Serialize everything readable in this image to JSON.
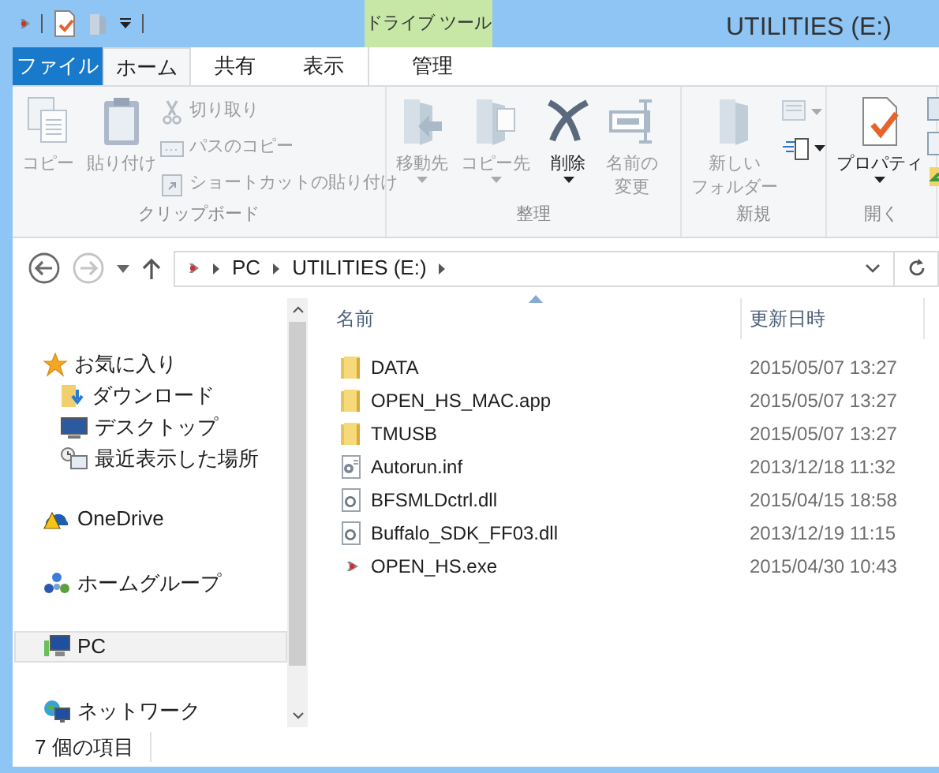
{
  "window": {
    "title": "UTILITIES (E:)"
  },
  "context_tab": {
    "label": "ドライブ ツール"
  },
  "tabs": [
    {
      "label": "ファイル",
      "kind": "file",
      "selected": false
    },
    {
      "label": "ホーム",
      "kind": "tab",
      "selected": true
    },
    {
      "label": "共有",
      "kind": "tab",
      "selected": false
    },
    {
      "label": "表示",
      "kind": "tab",
      "selected": false
    },
    {
      "label": "管理",
      "kind": "context",
      "selected": false
    }
  ],
  "ribbon_groups": [
    {
      "label": "クリップボード",
      "items": [
        {
          "kind": "copy",
          "lines": [
            "コピー"
          ],
          "disabled": true
        },
        {
          "kind": "paste",
          "lines": [
            "貼り付け"
          ],
          "disabled": true
        },
        {
          "kind": "cut",
          "lines": [
            "切り取り"
          ],
          "disabled": true
        },
        {
          "kind": "copypath",
          "lines": [
            "パスのコピー"
          ],
          "disabled": true
        },
        {
          "kind": "pasteshortcut",
          "lines": [
            "ショートカットの貼り付け"
          ],
          "disabled": true
        }
      ]
    },
    {
      "label": "整理",
      "items": [
        {
          "kind": "moveto",
          "lines": [
            "移動先"
          ],
          "disabled": true,
          "dropdown": true
        },
        {
          "kind": "copyto",
          "lines": [
            "コピー先"
          ],
          "disabled": true,
          "dropdown": true
        },
        {
          "kind": "delete",
          "lines": [
            "削除"
          ],
          "disabled": false,
          "dropdown": true
        },
        {
          "kind": "rename",
          "lines": [
            "名前の",
            "変更"
          ],
          "disabled": true
        }
      ]
    },
    {
      "label": "新規",
      "items": [
        {
          "kind": "newfolder",
          "lines": [
            "新しい",
            "フォルダー"
          ],
          "disabled": true
        },
        {
          "kind": "newitem",
          "disabled": true,
          "dropdown": true
        },
        {
          "kind": "easyaccess",
          "disabled": false,
          "dropdown": true
        }
      ]
    },
    {
      "label": "開く",
      "items": [
        {
          "kind": "properties",
          "lines": [
            "プロパティ"
          ],
          "disabled": false,
          "dropdown": true
        },
        {
          "kind": "openside"
        }
      ]
    }
  ],
  "navigation": {
    "back_disabled": false,
    "forward_disabled": true,
    "breadcrumbs": [
      "PC",
      "UTILITIES (E:)"
    ]
  },
  "sidebar": {
    "items": [
      {
        "kind": "favorites",
        "label": "お気に入り",
        "selected": false,
        "children": [
          {
            "kind": "downloads",
            "label": "ダウンロード",
            "selected": false
          },
          {
            "kind": "desktop",
            "label": "デスクトップ",
            "selected": false
          },
          {
            "kind": "recent",
            "label": "最近表示した場所",
            "selected": false
          }
        ]
      },
      {
        "kind": "onedrive",
        "label": "OneDrive",
        "selected": false
      },
      {
        "kind": "homegroup",
        "label": "ホームグループ",
        "selected": false
      },
      {
        "kind": "pc",
        "label": "PC",
        "selected": true
      },
      {
        "kind": "network",
        "label": "ネットワーク",
        "selected": false
      }
    ]
  },
  "table": {
    "columns": [
      {
        "label": "名前",
        "sorted": true
      },
      {
        "label": "更新日時"
      }
    ],
    "rows": [
      {
        "kind": "folder",
        "name": "DATA",
        "modified": "2015/05/07 13:27"
      },
      {
        "kind": "folder",
        "name": "OPEN_HS_MAC.app",
        "modified": "2015/05/07 13:27"
      },
      {
        "kind": "folder",
        "name": "TMUSB",
        "modified": "2015/05/07 13:27"
      },
      {
        "kind": "settings",
        "name": "Autorun.inf",
        "modified": "2013/12/18 11:32"
      },
      {
        "kind": "dll",
        "name": "BFSMLDctrl.dll",
        "modified": "2015/04/15 18:58"
      },
      {
        "kind": "dll",
        "name": "Buffalo_SDK_FF03.dll",
        "modified": "2013/12/19 11:15"
      },
      {
        "kind": "exe",
        "name": "OPEN_HS.exe",
        "modified": "2015/04/30 10:43"
      }
    ]
  },
  "status_bar": {
    "text": "7 個の項目"
  }
}
